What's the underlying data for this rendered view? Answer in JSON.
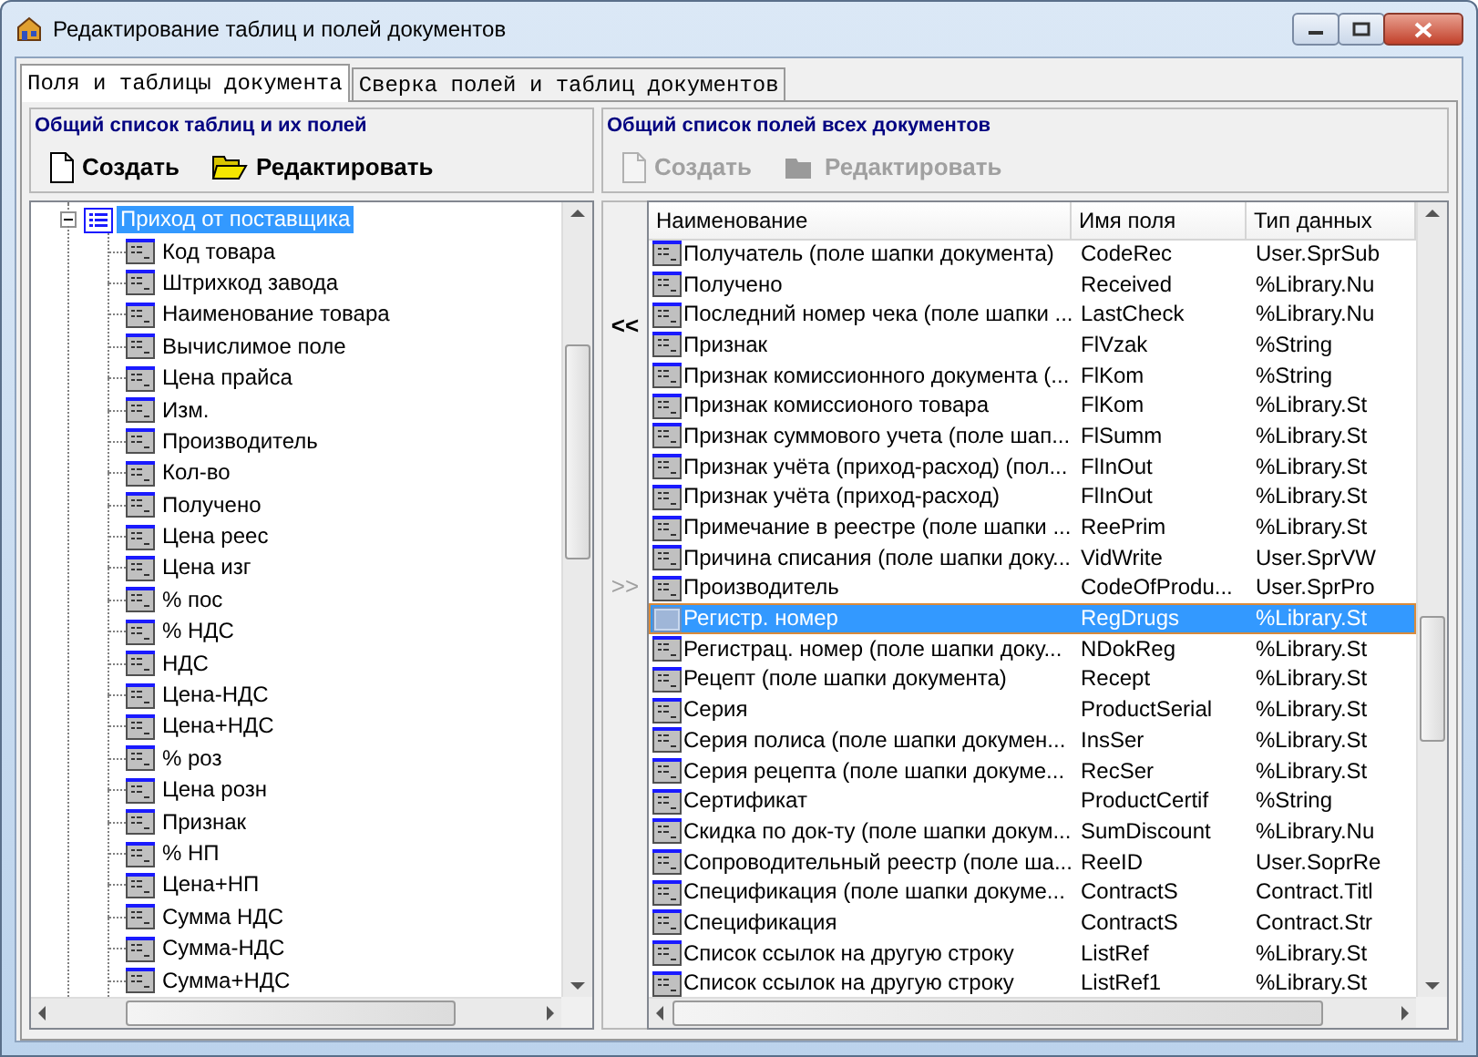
{
  "window": {
    "title": "Редактирование таблиц и полей документов"
  },
  "tabs": [
    {
      "label": "Поля и таблицы документа",
      "selected": true
    },
    {
      "label": "Сверка полей и таблиц документов",
      "selected": false
    }
  ],
  "left_panel": {
    "title": "Общий список таблиц и их полей",
    "toolbar": [
      {
        "label": "Создать",
        "kind": "new",
        "disabled": false
      },
      {
        "label": "Редактировать",
        "kind": "edit",
        "disabled": false
      }
    ],
    "tree": [
      {
        "label": "Приход от поставщика",
        "expanded": true,
        "selected": true,
        "children": [
          {
            "label": "Код товара",
            "selected": false
          },
          {
            "label": "Штрихкод завода",
            "selected": false
          },
          {
            "label": "Наименование  товара",
            "selected": false
          },
          {
            "label": "Вычислимое поле",
            "selected": false
          },
          {
            "label": "Цена прайса",
            "selected": false
          },
          {
            "label": "Изм.",
            "selected": false
          },
          {
            "label": "Производитель",
            "selected": false
          },
          {
            "label": "Кол-во",
            "selected": false
          },
          {
            "label": "Получено",
            "selected": false
          },
          {
            "label": "Цена реес",
            "selected": false
          },
          {
            "label": "Цена изг",
            "selected": false
          },
          {
            "label": "% пос",
            "selected": false
          },
          {
            "label": "% НДС",
            "selected": false
          },
          {
            "label": "НДС",
            "selected": false
          },
          {
            "label": "Цена-НДС",
            "selected": false
          },
          {
            "label": "Цена+НДС",
            "selected": false
          },
          {
            "label": "% роз",
            "selected": false
          },
          {
            "label": "Цена розн",
            "selected": false
          },
          {
            "label": "Признак",
            "selected": false
          },
          {
            "label": "% НП",
            "selected": false
          },
          {
            "label": "Цена+НП",
            "selected": false
          },
          {
            "label": "Сумма НДС",
            "selected": false
          },
          {
            "label": "Сумма-НДС",
            "selected": false
          },
          {
            "label": "Сумма+НДС",
            "selected": false
          }
        ]
      }
    ]
  },
  "transfer_buttons": [
    {
      "label": "<<",
      "disabled": false
    },
    {
      "label": ">>",
      "disabled": true
    }
  ],
  "right_panel": {
    "title": "Общий список полей всех документов",
    "toolbar": [
      {
        "label": "Создать",
        "kind": "new",
        "disabled": true
      },
      {
        "label": "Редактировать",
        "kind": "edit",
        "disabled": true
      }
    ],
    "table": {
      "columns": [
        "Наименование",
        "Имя поля",
        "Тип данных"
      ],
      "rows": [
        {
          "name": "Получатель (поле шапки документа)",
          "field": "CodeRec",
          "type": "User.SprSub",
          "selected": false
        },
        {
          "name": "Получено",
          "field": "Received",
          "type": "%Library.Nu",
          "selected": false
        },
        {
          "name": "Последний номер чека (поле шапки ...",
          "field": "LastCheck",
          "type": "%Library.Nu",
          "selected": false
        },
        {
          "name": "Признак",
          "field": "FlVzak",
          "type": "%String",
          "selected": false
        },
        {
          "name": "Признак комиссионного документа (...",
          "field": "FlKom",
          "type": "%String",
          "selected": false
        },
        {
          "name": "Признак комиссионого товара",
          "field": "FlKom",
          "type": "%Library.St",
          "selected": false
        },
        {
          "name": "Признак суммового учета (поле шап...",
          "field": "FlSumm",
          "type": "%Library.St",
          "selected": false
        },
        {
          "name": "Признак учёта (приход-расход) (пол...",
          "field": "FlInOut",
          "type": "%Library.St",
          "selected": false
        },
        {
          "name": "Признак учёта (приход-расход)",
          "field": "FlInOut",
          "type": "%Library.St",
          "selected": false
        },
        {
          "name": "Примечание в реестре (поле шапки ...",
          "field": "ReePrim",
          "type": "%Library.St",
          "selected": false
        },
        {
          "name": "Причина списания (поле шапки доку...",
          "field": "VidWrite",
          "type": "User.SprVW",
          "selected": false
        },
        {
          "name": "Производитель",
          "field": "CodeOfProdu...",
          "type": "User.SprPro",
          "selected": false
        },
        {
          "name": "Регистр. номер",
          "field": "RegDrugs",
          "type": "%Library.St",
          "selected": true
        },
        {
          "name": "Регистрац. номер (поле шапки доку...",
          "field": "NDokReg",
          "type": "%Library.St",
          "selected": false
        },
        {
          "name": "Рецепт (поле шапки документа)",
          "field": "Recept",
          "type": "%Library.St",
          "selected": false
        },
        {
          "name": "Серия",
          "field": "ProductSerial",
          "type": "%Library.St",
          "selected": false
        },
        {
          "name": "Серия полиса (поле шапки докумен...",
          "field": "InsSer",
          "type": "%Library.St",
          "selected": false
        },
        {
          "name": "Серия рецепта (поле шапки докуме...",
          "field": "RecSer",
          "type": "%Library.St",
          "selected": false
        },
        {
          "name": "Сертификат",
          "field": "ProductCertif",
          "type": "%String",
          "selected": false
        },
        {
          "name": "Скидка по док-ту (поле шапки докум...",
          "field": "SumDiscount",
          "type": "%Library.Nu",
          "selected": false
        },
        {
          "name": "Сопроводительный реестр (поле ша...",
          "field": "ReeID",
          "type": "User.SoprRe",
          "selected": false
        },
        {
          "name": "Спецификация (поле шапки докуме...",
          "field": "ContractS",
          "type": "Contract.Titl",
          "selected": false
        },
        {
          "name": "Спецификация",
          "field": "ContractS",
          "type": "Contract.Str",
          "selected": false
        },
        {
          "name": "Список ссылок на другую строку",
          "field": "ListRef",
          "type": "%Library.St",
          "selected": false
        },
        {
          "name": "Список ссылок на другую строку",
          "field": "ListRef1",
          "type": "%Library.St",
          "selected": false
        }
      ]
    }
  }
}
